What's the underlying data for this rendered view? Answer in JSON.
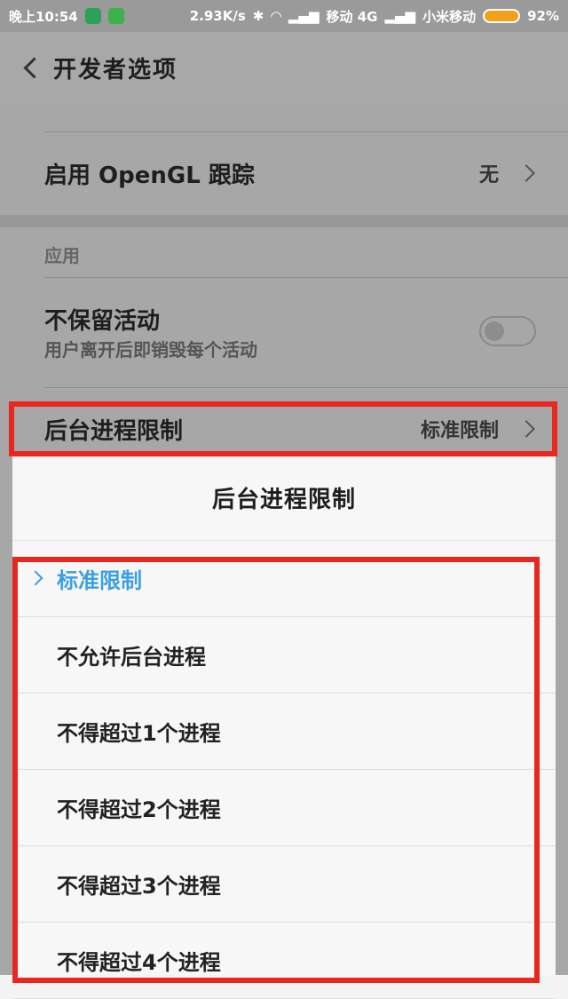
{
  "status_bar": {
    "time": "晚上10:54",
    "speed": "2.93K/s",
    "carrier1": "移动 4G",
    "carrier2": "小米移动",
    "battery": "92%"
  },
  "app_bar": {
    "title": "开发者选项"
  },
  "settings": {
    "opengl": {
      "title": "启用 OpenGL 跟踪",
      "value": "无"
    },
    "section_label": "应用",
    "no_keep": {
      "title": "不保留活动",
      "subtitle": "用户离开后即销毁每个活动",
      "toggle_on": false
    },
    "bg_limit": {
      "title": "后台进程限制",
      "value": "标准限制"
    }
  },
  "dialog": {
    "title": "后台进程限制",
    "selected_index": 0,
    "options": [
      "标准限制",
      "不允许后台进程",
      "不得超过1个进程",
      "不得超过2个进程",
      "不得超过3个进程",
      "不得超过4个进程"
    ]
  }
}
